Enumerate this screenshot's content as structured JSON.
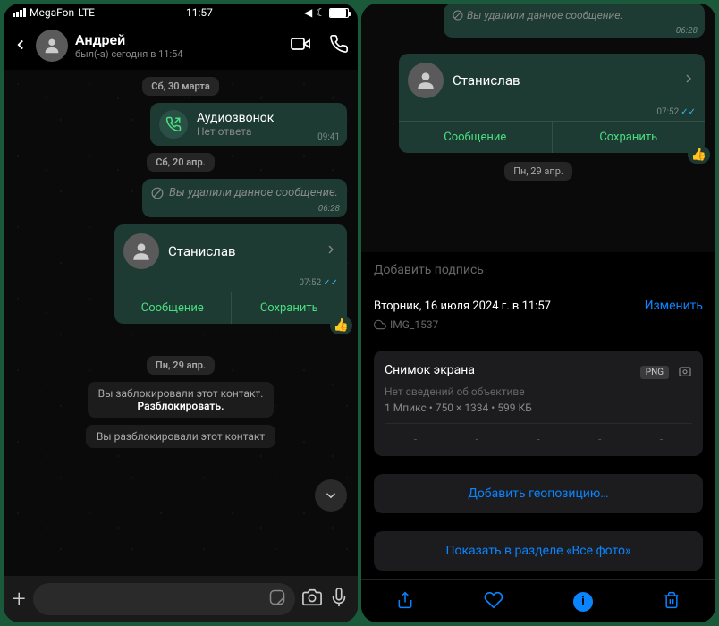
{
  "left": {
    "status": {
      "carrier": "MegaFon",
      "network": "LTE",
      "time": "11:57"
    },
    "header": {
      "name": "Андрей",
      "status": "был(-а) сегодня в 11:54"
    },
    "dates": {
      "d1": "Сб, 30 марта",
      "d2": "Сб, 20 апр.",
      "d3": "Пн, 29 апр."
    },
    "call": {
      "title": "Аудиозвонок",
      "sub": "Нет ответа",
      "time": "09:41"
    },
    "deleted": {
      "text": "Вы удалили данное сообщение.",
      "time": "06:28"
    },
    "contact_card": {
      "name": "Станислав",
      "time": "07:52",
      "action1": "Сообщение",
      "action2": "Сохранить"
    },
    "sys1": "Вы заблокировали этот контакт.",
    "sys1b": "Разблокировать.",
    "sys2": "Вы разблокировали этот контакт"
  },
  "right": {
    "preview_deleted": {
      "text": "Вы удалили данное сообщение.",
      "time": "06:28"
    },
    "contact_card": {
      "name": "Станислав",
      "time": "07:52",
      "action1": "Сообщение",
      "action2": "Сохранить"
    },
    "date": "Пн, 29 апр.",
    "caption_placeholder": "Добавить подпись",
    "meta": {
      "date": "Вторник, 16 июля 2024 г. в 11:57",
      "edit": "Изменить",
      "filename": "IMG_1537"
    },
    "info": {
      "title": "Снимок экрана",
      "badge": "PNG",
      "lens": "Нет сведений об объективе",
      "specs": "1 Мпикс  •  750 × 1334  •  599 КБ"
    },
    "geo_btn": "Добавить геопозицию…",
    "show_btn": "Показать в разделе «Все фото»"
  }
}
